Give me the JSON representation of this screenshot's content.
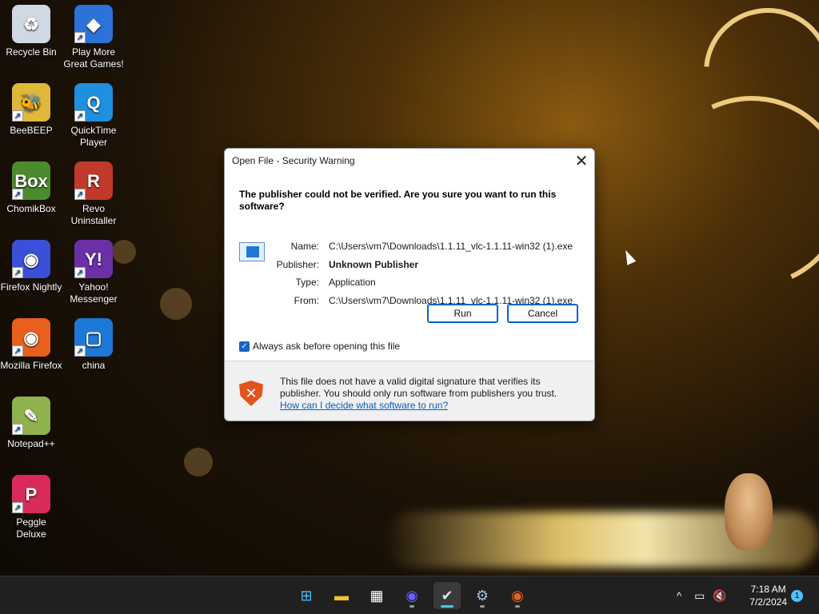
{
  "desktop": {
    "icons": [
      {
        "label": "Recycle Bin",
        "glyph": "♻",
        "color": "#cfd8e3",
        "shortcut": false
      },
      {
        "label": "Play More Great Games!",
        "glyph": "◆",
        "color": "#2b72d9",
        "shortcut": true
      },
      {
        "label": "BeeBEEP",
        "glyph": "🐝",
        "color": "#e0b83a",
        "shortcut": true
      },
      {
        "label": "QuickTime Player",
        "glyph": "Q",
        "color": "#1f8fe0",
        "shortcut": true
      },
      {
        "label": "ChomikBox",
        "glyph": "Box",
        "color": "#4c8a2e",
        "shortcut": true
      },
      {
        "label": "Revo Uninstaller",
        "glyph": "R",
        "color": "#c0392b",
        "shortcut": true
      },
      {
        "label": "Firefox Nightly",
        "glyph": "◉",
        "color": "#3b4fd8",
        "shortcut": true
      },
      {
        "label": "Yahoo! Messenger",
        "glyph": "Y!",
        "color": "#6b2fa8",
        "shortcut": true
      },
      {
        "label": "Mozilla Firefox",
        "glyph": "◉",
        "color": "#e8601c",
        "shortcut": true
      },
      {
        "label": "china",
        "glyph": "▢",
        "color": "#1e78d7",
        "shortcut": true
      },
      {
        "label": "Notepad++",
        "glyph": "✎",
        "color": "#8fb24c",
        "shortcut": true
      },
      {
        "label": "Peggle Deluxe",
        "glyph": "P",
        "color": "#d92b5a",
        "shortcut": true
      }
    ]
  },
  "dialog": {
    "title": "Open File - Security Warning",
    "close_glyph": "✕",
    "headline": "The publisher could not be verified.  Are you sure you want to run this software?",
    "fields": [
      {
        "label": "Name:",
        "value": "C:\\Users\\vm7\\Downloads\\1.1.11_vlc-1.1.11-win32 (1).exe",
        "bold": false
      },
      {
        "label": "Publisher:",
        "value": "Unknown Publisher",
        "bold": true
      },
      {
        "label": "Type:",
        "value": "Application",
        "bold": false
      },
      {
        "label": "From:",
        "value": "C:\\Users\\vm7\\Downloads\\1.1.11_vlc-1.1.11-win32 (1).exe",
        "bold": false
      }
    ],
    "run_label": "Run",
    "cancel_label": "Cancel",
    "checkbox_label": "Always ask before opening this file",
    "checkbox_checked": true,
    "warning_text": "This file does not have a valid digital signature that verifies its publisher.  You should only run software from publishers you trust.",
    "warning_link": "How can I decide what software to run?"
  },
  "taskbar": {
    "apps": [
      {
        "name": "start",
        "glyph": "⊞",
        "color": "#4cc2ff"
      },
      {
        "name": "file-explorer",
        "glyph": "▬",
        "color": "#f2c230"
      },
      {
        "name": "microsoft-store",
        "glyph": "▦",
        "color": "#ffffff"
      },
      {
        "name": "firefox-nightly",
        "glyph": "◉",
        "color": "#6a5cff"
      },
      {
        "name": "task-app",
        "glyph": "✔",
        "color": "#e0e0e0"
      },
      {
        "name": "settings",
        "glyph": "⚙",
        "color": "#9ec3e8"
      },
      {
        "name": "firefox",
        "glyph": "◉",
        "color": "#e8601c"
      }
    ],
    "tray": {
      "chevron": "^",
      "time": "7:18 AM",
      "date": "7/2/2024",
      "notification_count": "1"
    }
  }
}
